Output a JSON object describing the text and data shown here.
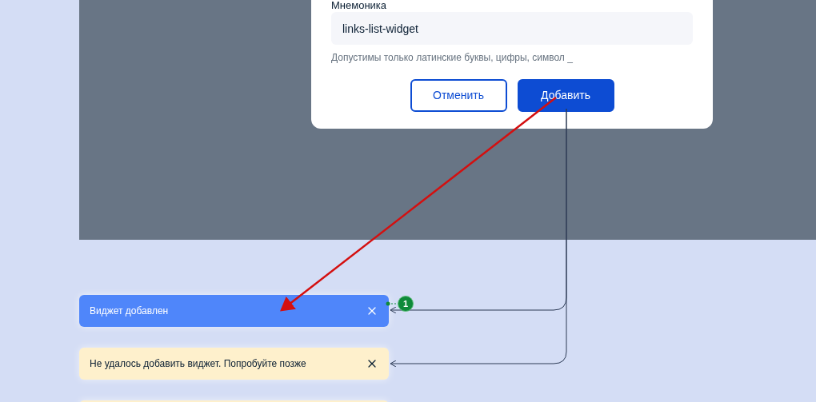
{
  "dialog": {
    "field_label": "Мнемоника",
    "field_value": "links-list-widget",
    "hint": "Допустимы только латинские буквы, цифры, символ _",
    "buttons": [
      {
        "label": "Отменить",
        "kind": "secondary"
      },
      {
        "label": "Добавить",
        "kind": "primary"
      }
    ]
  },
  "toasts": [
    {
      "text": "Виджет добавлен",
      "kind": "info"
    },
    {
      "text": "Не удалось добавить виджет. Попробуйте позже",
      "kind": "warning"
    },
    {
      "kind": "warning"
    }
  ],
  "annotation": {
    "badge": "1"
  }
}
